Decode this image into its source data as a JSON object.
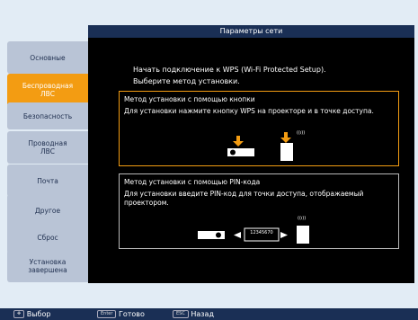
{
  "header": {
    "title": "Параметры сети"
  },
  "sidebar": {
    "items": [
      {
        "label": "Основные"
      },
      {
        "label": "Беспроводная ЛВС"
      },
      {
        "label": "Безопасность"
      },
      {
        "label": "Проводная ЛВС"
      },
      {
        "label": "Почта"
      },
      {
        "label": "Другое"
      },
      {
        "label": "Сброс"
      },
      {
        "label": "Установка завершена"
      }
    ]
  },
  "main": {
    "intro_line1": "Начать подключение к WPS (Wi-Fi Protected Setup).",
    "intro_line2": "Выберите метод установки.",
    "methods": [
      {
        "title": "Метод установки с помощью кнопки",
        "desc": "Для установки нажмите кнопку WPS на проекторе и в точке доступа.",
        "wave": "((ı))"
      },
      {
        "title": "Метод установки с помощью PIN-кода",
        "desc": "Для установки введите PIN-код для точки доступа, отображаемый проектором.",
        "pin": "12345670",
        "wave": "((ı))"
      }
    ]
  },
  "footer": {
    "select_key": "✥",
    "select_label": "Выбор",
    "enter_key": "Enter",
    "enter_label": "Готово",
    "esc_key": "ESC",
    "esc_label": "Назад"
  },
  "colors": {
    "accent": "#f39c12",
    "bar": "#1a2f55",
    "tab": "#b9c4d6"
  }
}
